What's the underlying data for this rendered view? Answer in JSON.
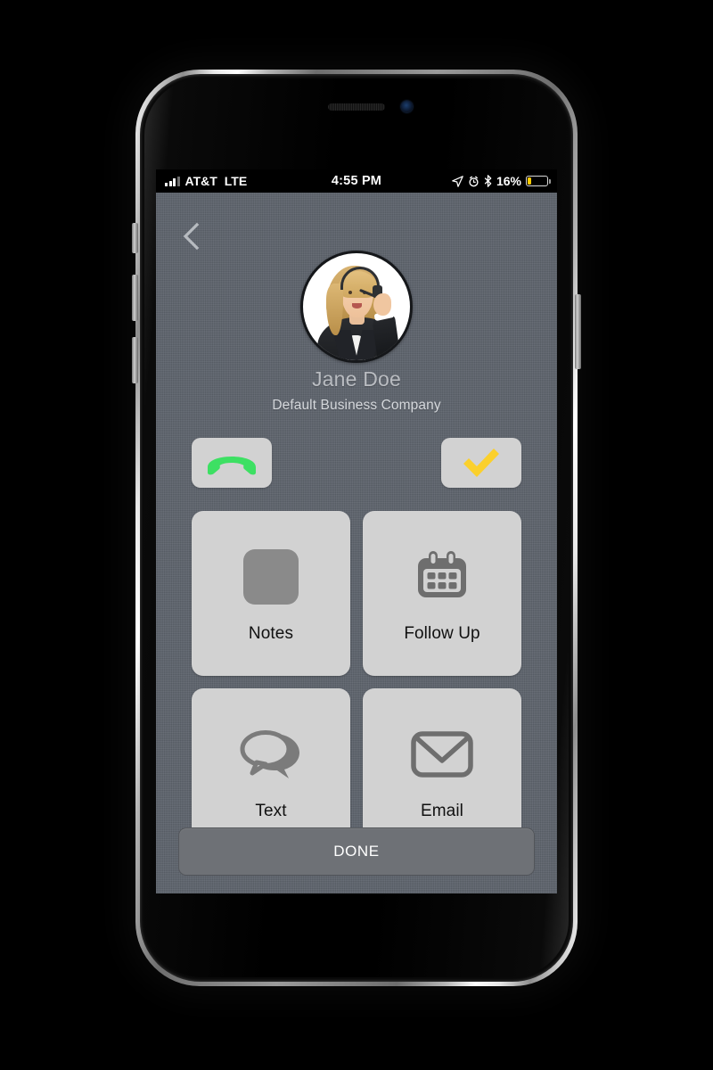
{
  "status_bar": {
    "carrier": "AT&T",
    "network": "LTE",
    "time": "4:55 PM",
    "battery_percent": "16%",
    "battery_level": 16,
    "icons": [
      "signal-bars-icon",
      "location-arrow-icon",
      "alarm-clock-icon",
      "bluetooth-icon",
      "battery-icon"
    ]
  },
  "nav": {
    "back_label": "chevron-left-icon"
  },
  "contact": {
    "name": "Jane Doe",
    "company": "Default Business Company",
    "avatar_alt": "woman-with-headset-avatar"
  },
  "call_actions": [
    {
      "name": "hangup",
      "icon": "phone-handset-icon",
      "color": "#3de063"
    },
    {
      "name": "accept",
      "icon": "checkmark-icon",
      "color": "#fbd02c"
    }
  ],
  "tiles": [
    {
      "label": "Notes",
      "icon": "notes-icon"
    },
    {
      "label": "Follow Up",
      "icon": "calendar-icon"
    },
    {
      "label": "Text",
      "icon": "speech-bubbles-icon"
    },
    {
      "label": "Email",
      "icon": "envelope-icon"
    }
  ],
  "footer": {
    "done_label": "DONE"
  },
  "theme": {
    "screen_bg": "#5e646d",
    "card_bg": "#d2d2d2",
    "icon_gray": "#6e6e6e",
    "accent_green": "#3de063",
    "accent_yellow": "#fbd02c",
    "done_bg": "#6e7176"
  }
}
